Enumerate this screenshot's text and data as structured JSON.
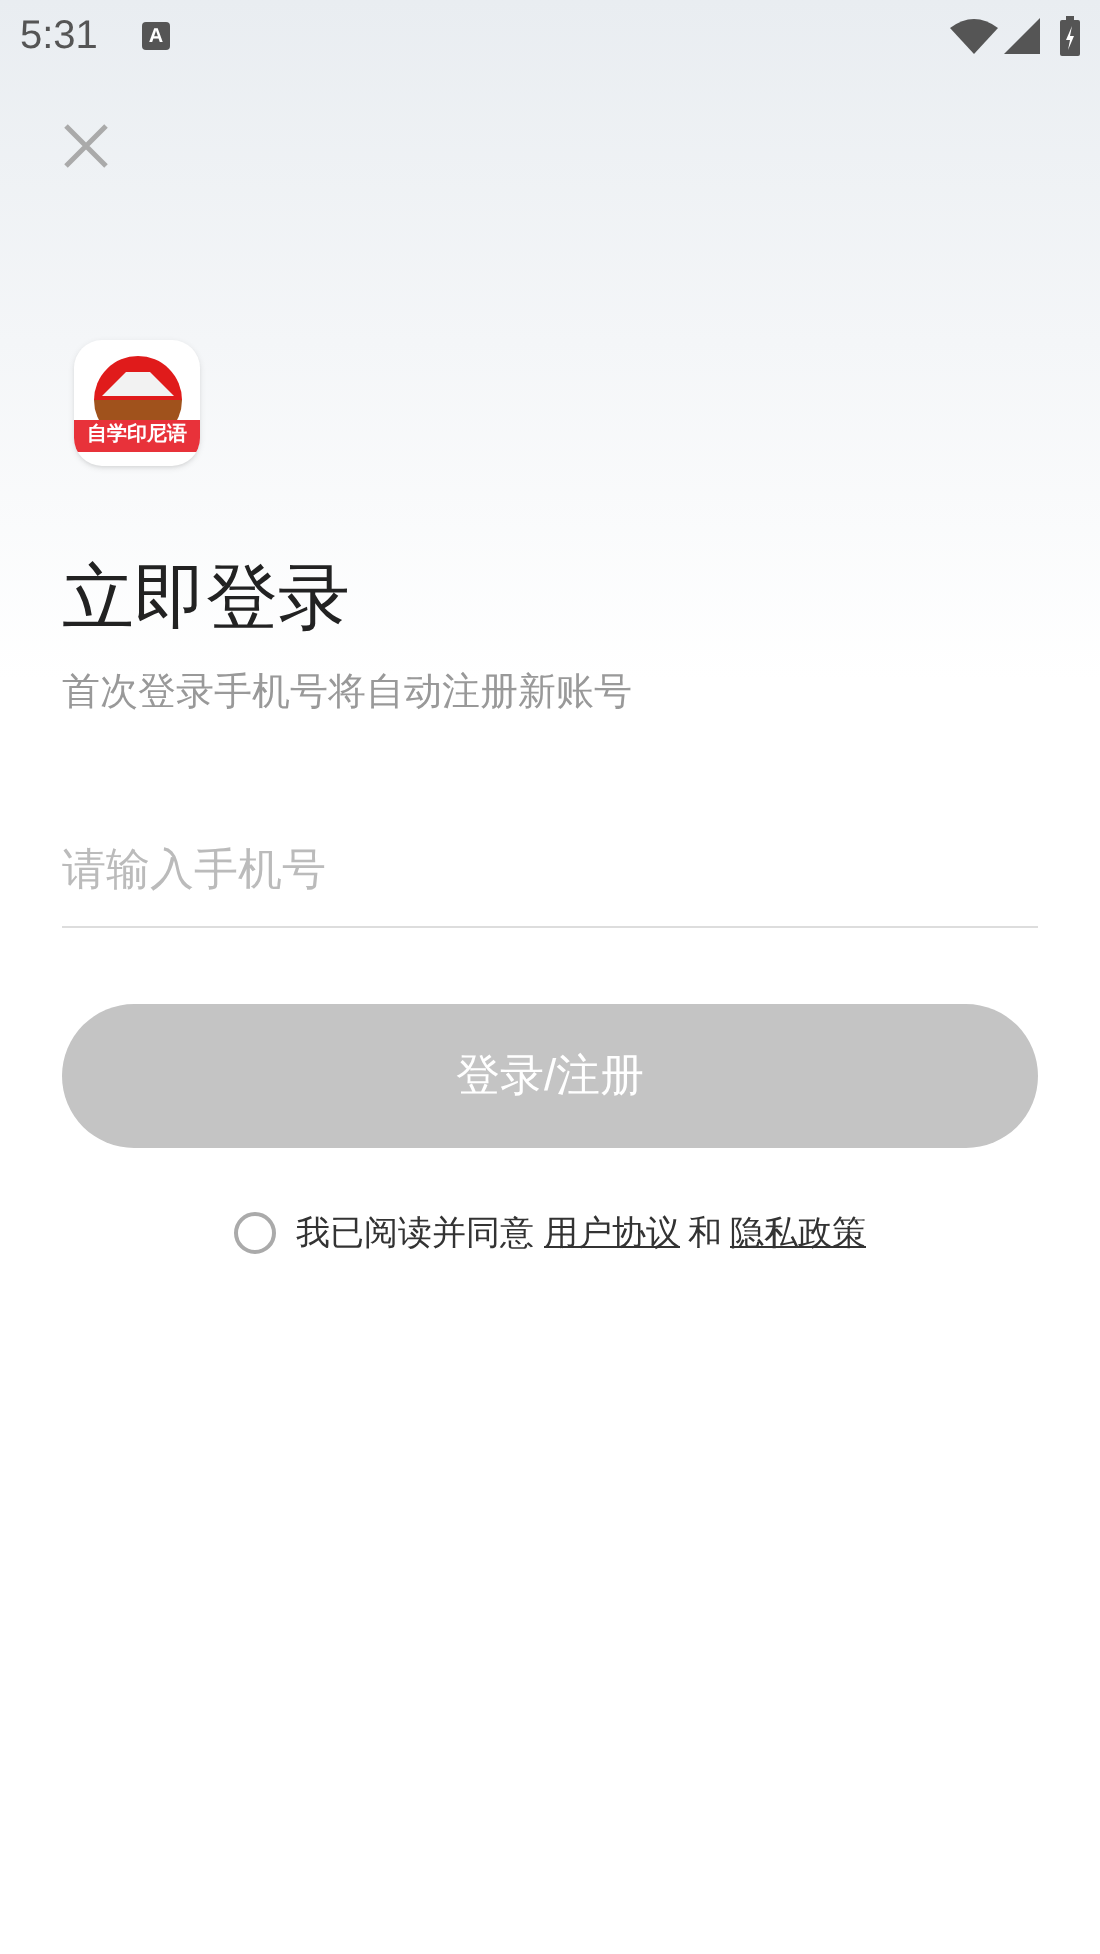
{
  "status_bar": {
    "time": "5:31",
    "notification_icon": "A"
  },
  "app_logo": {
    "caption": "自学印尼语"
  },
  "title": "立即登录",
  "subtitle": "首次登录手机号将自动注册新账号",
  "phone_field": {
    "placeholder": "请输入手机号"
  },
  "login_button": {
    "label": "登录/注册",
    "disabled": true
  },
  "agreement": {
    "checked": false,
    "text": "我已阅读并同意",
    "links": [
      {
        "label": "用户协议"
      },
      {
        "label": "隐私政策"
      }
    ],
    "joiner": "和"
  }
}
